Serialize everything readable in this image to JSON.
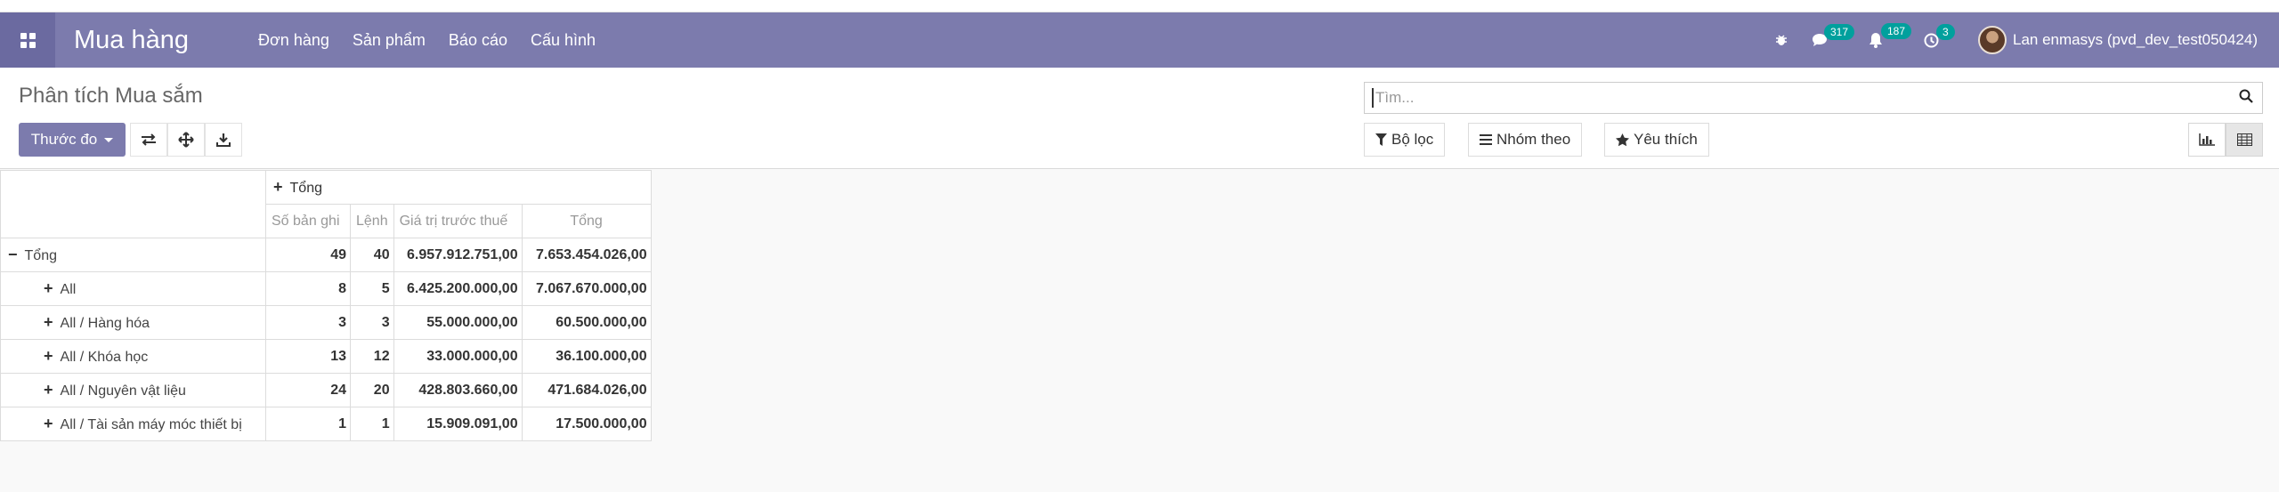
{
  "navbar": {
    "brand": "Mua hàng",
    "menu": [
      "Đơn hàng",
      "Sản phẩm",
      "Báo cáo",
      "Cấu hình"
    ],
    "messages_count": "317",
    "notifications_count": "187",
    "activities_count": "3",
    "user": "Lan enmasys (pvd_dev_test050424)"
  },
  "control": {
    "title": "Phân tích Mua sắm",
    "measure_label": "Thước đo",
    "search_placeholder": "Tìm...",
    "filter_label": "Bộ lọc",
    "groupby_label": "Nhóm theo",
    "favorite_label": "Yêu thích"
  },
  "pivot": {
    "col_header": "Tổng",
    "measures": [
      "Số bản ghi",
      "Lệnh",
      "Giá trị trước thuế",
      "Tổng"
    ],
    "rows": [
      {
        "label": "Tổng",
        "values": [
          "49",
          "40",
          "6.957.912.751,00",
          "7.653.454.026,00"
        ]
      },
      {
        "label": "All",
        "values": [
          "8",
          "5",
          "6.425.200.000,00",
          "7.067.670.000,00"
        ]
      },
      {
        "label": "All / Hàng hóa",
        "values": [
          "3",
          "3",
          "55.000.000,00",
          "60.500.000,00"
        ]
      },
      {
        "label": "All / Khóa học",
        "values": [
          "13",
          "12",
          "33.000.000,00",
          "36.100.000,00"
        ]
      },
      {
        "label": "All / Nguyên vật liệu",
        "values": [
          "24",
          "20",
          "428.803.660,00",
          "471.684.026,00"
        ]
      },
      {
        "label": "All / Tài sản máy móc thiết bị",
        "values": [
          "1",
          "1",
          "15.909.091,00",
          "17.500.000,00"
        ]
      }
    ]
  },
  "colors": {
    "navbar": "#7c7bad",
    "badge": "#00a09d"
  },
  "icons": [
    "apps-icon",
    "bug-icon",
    "chat-icon",
    "bell-icon",
    "clock-icon",
    "flip-axis-icon",
    "expand-icon",
    "download-icon",
    "search-icon",
    "filter-icon",
    "list-icon",
    "star-icon",
    "bar-chart-icon",
    "table-icon"
  ]
}
